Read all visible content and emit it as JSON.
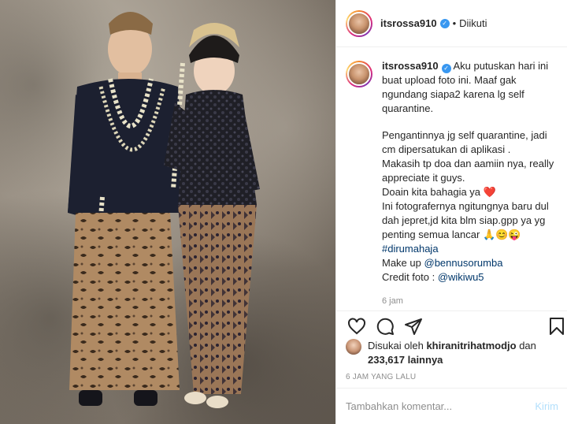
{
  "post": {
    "image_alt": "",
    "username": "itsrossa910",
    "follow_status": "Diikuti",
    "separator": "•"
  },
  "caption": {
    "username": "itsrossa910",
    "lines_block1": [
      "Aku putuskan hari ini",
      "buat upload foto ini. Maaf gak",
      "ngundang siapa2 karena lg self",
      "quarantine."
    ],
    "lines_block2": [
      "Pengantinnya jg self quarantine, jadi",
      "cm dipersatukan di aplikasi .",
      "Makasih tp doa dan aamiin nya, really",
      "appreciate it guys."
    ],
    "doain": "Doain kita bahagia ya",
    "heart": "❤️",
    "lines_block3": [
      "Ini fotografernya ngitungnya baru dul",
      "dah jepret,jd kita blm siap.gpp ya yg"
    ],
    "lancar": "penting semua lancar",
    "lancar_emoji": "🙏😊😜",
    "hashtag": "#dirumahaja",
    "makeup_label": "Make up",
    "makeup_handle": "@bennusorumba",
    "credit_label": "Credit foto :",
    "credit_handle": "@wikiwu5",
    "time": "6 jam"
  },
  "likes": {
    "prefix": "Disukai oleh",
    "user": "khiranitrihatmodjo",
    "conj": "dan",
    "count": "233,617 lainnya"
  },
  "post_time": "6 JAM YANG LALU",
  "comment_box": {
    "placeholder": "Tambahkan komentar...",
    "post_label": "Kirim"
  },
  "colors": {
    "link": "#00376b",
    "verified": "#3897f0",
    "muted": "#8e8e8e",
    "post_disabled": "#b2dffc"
  },
  "icons": [
    "heart-icon",
    "comment-icon",
    "share-icon",
    "bookmark-icon",
    "verified-badge-icon"
  ]
}
